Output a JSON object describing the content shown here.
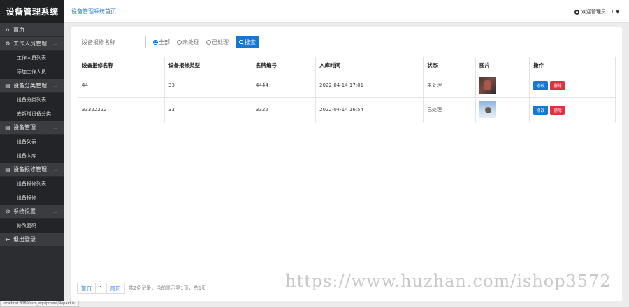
{
  "brand": "设备管理系统",
  "sidebar": {
    "home": "首页",
    "groups": [
      {
        "label": "工作人员管理",
        "icon": "gear-icon",
        "items": [
          "工作人员列表",
          "添加工作人员"
        ]
      },
      {
        "label": "设备分类管理",
        "icon": "document-icon",
        "items": [
          "设备分类列表",
          "去新增设备分类"
        ]
      },
      {
        "label": "设备管理",
        "icon": "document-icon",
        "items": [
          "设备列表",
          "设备入库"
        ]
      },
      {
        "label": "设备报修管理",
        "icon": "document-icon",
        "items": [
          "设备报修列表",
          "设备报修"
        ]
      },
      {
        "label": "系统设置",
        "icon": "gear-icon",
        "items": [
          "修改密码"
        ]
      }
    ],
    "logout": "退出登录"
  },
  "header": {
    "breadcrumb": "设备管理系统首页",
    "user": "欢迎管理员：1"
  },
  "search": {
    "placeholder": "设备报修名称",
    "options": [
      "全部",
      "未处理",
      "已处理"
    ],
    "selected": "全部",
    "button": "搜索"
  },
  "table": {
    "columns": [
      "设备报修名称",
      "设备报修类型",
      "名牌编号",
      "入库时间",
      "状态",
      "图片",
      "操作"
    ],
    "rows": [
      {
        "name": "44",
        "type": "33",
        "brand_no": "4444",
        "time": "2022-04-14 17:01",
        "status": "未处理"
      },
      {
        "name": "33322222",
        "type": "33",
        "brand_no": "3322",
        "time": "2022-04-14 16:54",
        "status": "已处理"
      }
    ],
    "edit_label": "修改",
    "delete_label": "删除"
  },
  "pagination": {
    "first": "首页",
    "current": "1",
    "last": "尾页",
    "info": "共2条记录，当前显示第1页，总1页"
  },
  "watermark": "https://www.huzhan.com/ishop3572",
  "status_url": "localhost:8089/ssm_equipment/RepairList",
  "colors": {
    "accent": "#1677d6",
    "danger": "#d9343f",
    "sidebar": "#2b2d30"
  }
}
